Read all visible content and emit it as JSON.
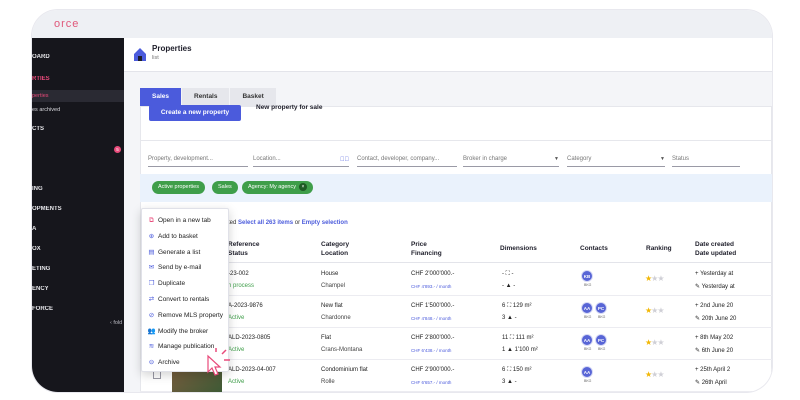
{
  "app": {
    "brand": "orce"
  },
  "colors": {
    "accent": "#4b5bdc",
    "brand": "#e84a7a",
    "chip": "#3f9e4a",
    "sidebar": "#16161c"
  },
  "sidebar": {
    "items": [
      {
        "label": "OARD",
        "active": false
      },
      {
        "label": "RTIES",
        "active": true
      },
      {
        "label": "CTS",
        "active": false
      },
      {
        "label": "",
        "badge": "5",
        "active": false
      },
      {
        "label": "ING",
        "active": false
      },
      {
        "label": "OPMENTS",
        "active": false
      },
      {
        "label": "A",
        "active": false
      },
      {
        "label": "OX",
        "active": false
      },
      {
        "label": "ETING",
        "active": false
      },
      {
        "label": "ENCY",
        "active": false
      },
      {
        "label": "FORCE",
        "active": false
      }
    ],
    "subitems": [
      {
        "label": "perties",
        "active": true
      },
      {
        "label": "es archived",
        "active": false
      }
    ],
    "fold_label": "fold",
    "fold_icon": "chevron-left-icon"
  },
  "header": {
    "title": "Properties",
    "subtitle": "list",
    "icon": "home-icon"
  },
  "tabs": [
    {
      "label": "Sales",
      "active": true
    },
    {
      "label": "Rentals",
      "active": false
    },
    {
      "label": "Basket",
      "active": false
    }
  ],
  "create_button": "Create a new property",
  "new_label": "New property for sale",
  "filters": {
    "property": "Property, development...",
    "location": "Location...",
    "contact": "Contact, developer, company...",
    "broker": "Broker in charge",
    "category": "Category",
    "status": "Status"
  },
  "chips": [
    {
      "label": "Active properties"
    },
    {
      "label": "Sales"
    },
    {
      "label": "Agency: My agency",
      "removable": true
    }
  ],
  "selection": {
    "prefix": "ted",
    "select_all": "Select all 263 items",
    "or": "or",
    "empty": "Empty selection"
  },
  "table": {
    "columns": [
      {
        "line1": "Reference",
        "line2": "Status"
      },
      {
        "line1": "Category",
        "line2": "Location"
      },
      {
        "line1": "Price",
        "line2": "Financing"
      },
      {
        "line1": "Dimensions",
        "line2": ""
      },
      {
        "line1": "Contacts",
        "line2": ""
      },
      {
        "line1": "Ranking",
        "line2": ""
      },
      {
        "line1": "Date created",
        "line2": "Date updated"
      }
    ],
    "rows": [
      {
        "reference": "-23-002",
        "status": "n process",
        "category": "House",
        "location": "Champel",
        "price": "CHF 2'000'000.-",
        "financing": "CHF 4'893.- / month",
        "dim1": "- ⛶ -",
        "dim2": "- ▲ -",
        "contacts": [
          {
            "initials": "KB",
            "sub": "BKG"
          }
        ],
        "stars": 1,
        "created": "+ Yesterday at",
        "updated": "✎ Yesterday at"
      },
      {
        "reference": "A-2023-9876",
        "status": "Active",
        "category": "New flat",
        "location": "Chardonne",
        "price": "CHF 1'500'000.-",
        "financing": "CHF 4'848.- / month",
        "dim1": "6 ⛶ 129 m²",
        "dim2": "3 ▲ -",
        "contacts": [
          {
            "initials": "AA",
            "sub": "BKG"
          },
          {
            "initials": "PC",
            "sub": "BKG"
          }
        ],
        "stars": 1,
        "created": "+ 2nd June 20",
        "updated": "✎ 20th June 20"
      },
      {
        "reference": "ALD-2023-0805",
        "status": "Active",
        "category": "Flat",
        "location": "Crans-Montana",
        "price": "CHF 2'800'000.-",
        "financing": "CHF 6'438.- / month",
        "dim1": "11 ⛶ 111 m²",
        "dim2": "1 ▲ 1'100 m²",
        "contacts": [
          {
            "initials": "AA",
            "sub": "BKG"
          },
          {
            "initials": "PC",
            "sub": "BKG"
          }
        ],
        "stars": 1,
        "created": "+ 8th May 202",
        "updated": "✎ 6th June 20"
      },
      {
        "reference": "ALD-2023-04-007",
        "status": "Active",
        "category": "Condominium flat",
        "location": "Rolle",
        "price": "CHF 2'900'000.-",
        "financing": "CHF 6'657.- / month",
        "dim1": "6 ⛶ 150 m²",
        "dim2": "3 ▲ -",
        "contacts": [
          {
            "initials": "AA",
            "sub": "BKG"
          }
        ],
        "stars": 1,
        "created": "+ 25th April 2",
        "updated": "✎ 26th April"
      }
    ]
  },
  "context_menu": [
    {
      "label": "Open in a new tab",
      "icon": "external-link-icon"
    },
    {
      "label": "Add to basket",
      "icon": "basket-icon"
    },
    {
      "label": "Generate a list",
      "icon": "list-icon"
    },
    {
      "label": "Send by e-mail",
      "icon": "mail-icon"
    },
    {
      "label": "Duplicate",
      "icon": "copy-icon"
    },
    {
      "label": "Convert to rentals",
      "icon": "convert-icon"
    },
    {
      "label": "Remove MLS property",
      "icon": "remove-icon"
    },
    {
      "label": "Modify the broker",
      "icon": "users-icon"
    },
    {
      "label": "Manage publication",
      "icon": "publication-icon"
    },
    {
      "label": "Archive",
      "icon": "archive-icon"
    }
  ]
}
